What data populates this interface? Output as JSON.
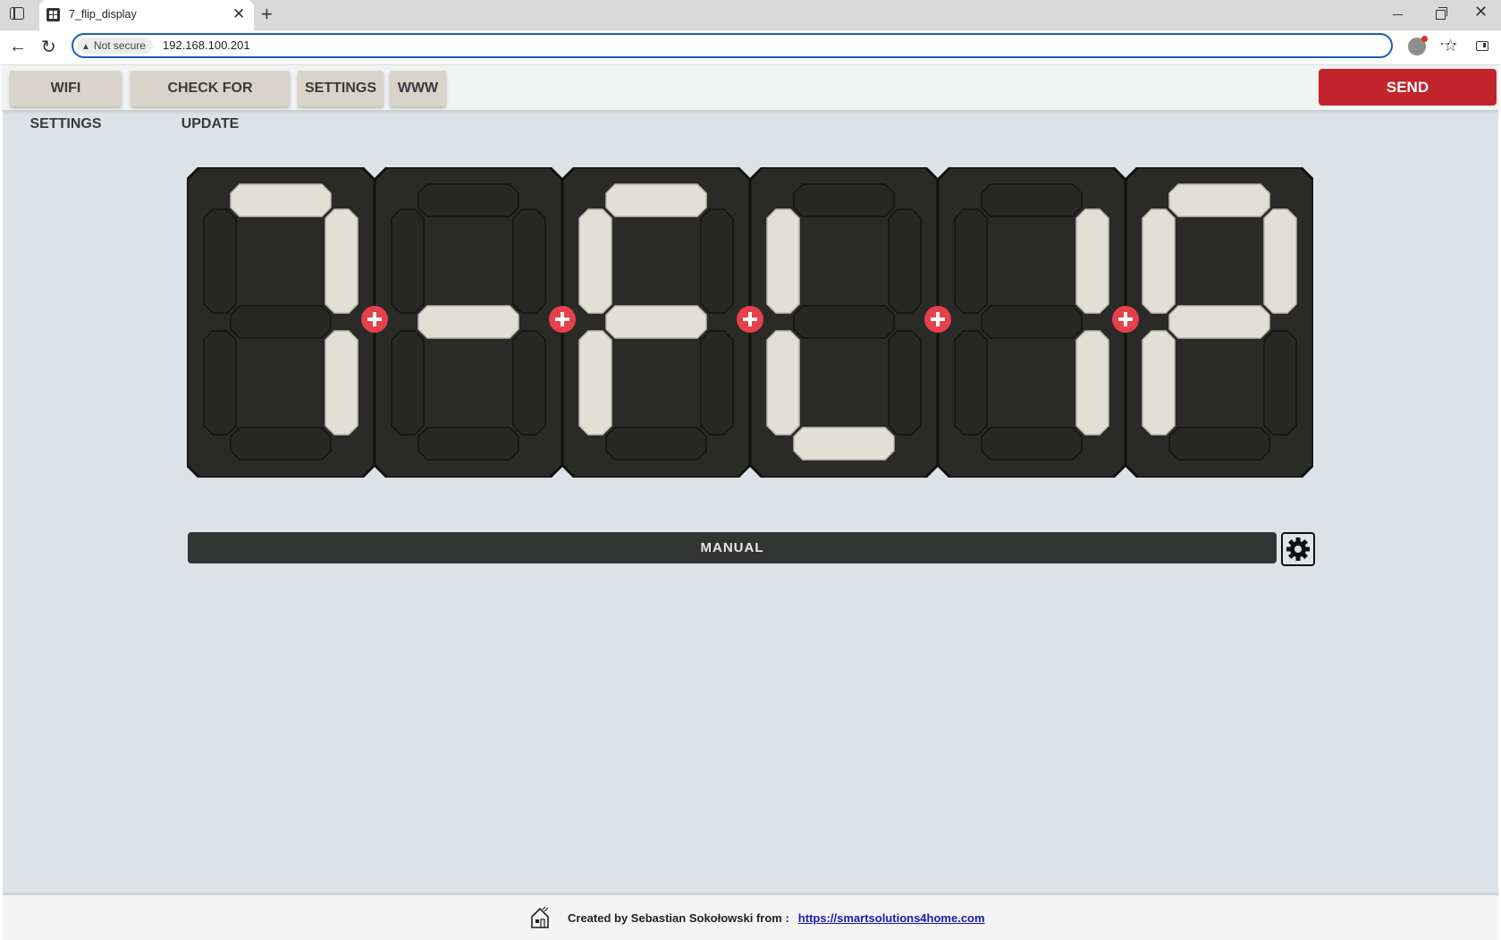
{
  "browser": {
    "tab_title": "7_flip_display",
    "security_label": "Not secure",
    "url": "192.168.100.201"
  },
  "nav": {
    "buttons": [
      {
        "label": "WIFI SETTINGS"
      },
      {
        "label": "CHECK FOR UPDATE"
      },
      {
        "label": "SETTINGS"
      },
      {
        "label": "WWW"
      }
    ],
    "send_label": "SEND"
  },
  "display": {
    "digits": [
      {
        "lit": [
          "a",
          "b",
          "c"
        ]
      },
      {
        "lit": [
          "g"
        ]
      },
      {
        "lit": [
          "a",
          "f",
          "g",
          "e"
        ]
      },
      {
        "lit": [
          "f",
          "e",
          "d"
        ]
      },
      {
        "lit": [
          "b",
          "c"
        ]
      },
      {
        "lit": [
          "a",
          "b",
          "f",
          "g",
          "e"
        ]
      }
    ],
    "colors": {
      "panel": "#2a2a27",
      "lit": "#e2dfd4",
      "unlit": "#272724",
      "plus": "#e8404a"
    }
  },
  "mode": {
    "label": "MANUAL"
  },
  "footer": {
    "text": "Created by Sebastian Sokołowski from :",
    "link": "https://smartsolutions4home.com"
  }
}
